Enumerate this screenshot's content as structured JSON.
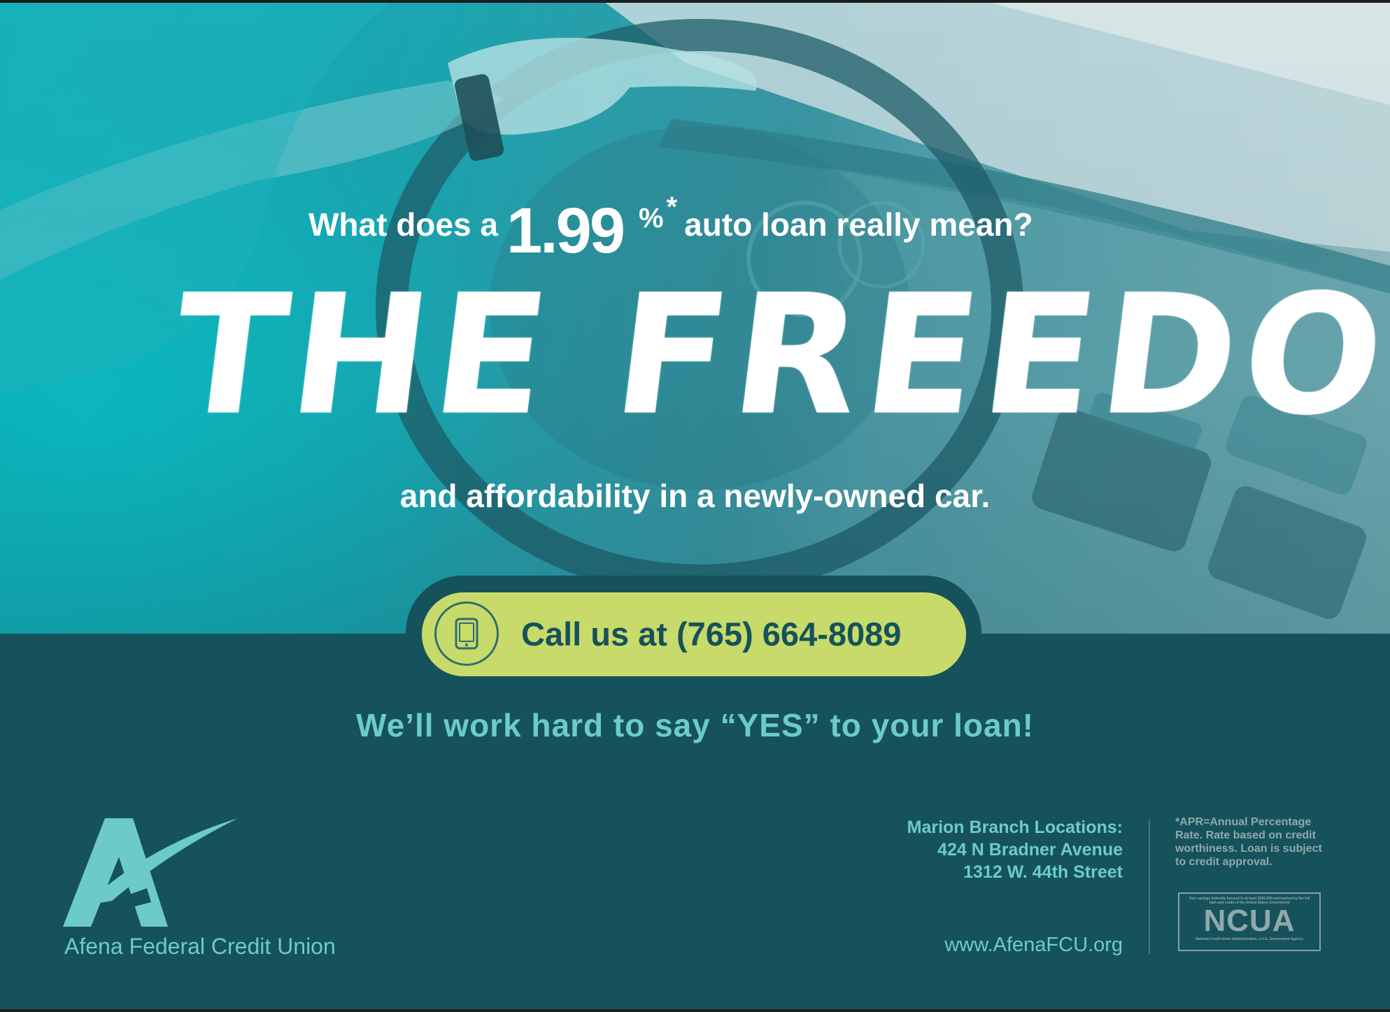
{
  "colors": {
    "teal_dark": "#16525b",
    "teal_bright": "#12aeb9",
    "accent_lime": "#c8da6a",
    "accent_aqua": "#6ccbc8",
    "white": "#ffffff"
  },
  "hero": {
    "lead_before": "What does a",
    "rate": "1.99",
    "percent": "%",
    "asterisk": "*",
    "lead_after": "auto loan really mean?",
    "headline": "THE FREEDOM",
    "subline": "and affordability in a newly-owned car."
  },
  "call": {
    "icon": "phone-icon",
    "text": "Call us at (765) 664-8089"
  },
  "tagline": "We’ll work hard to say “YES” to your loan!",
  "brand": {
    "logo_icon": "afena-logo-icon",
    "name": "Afena Federal Credit Union"
  },
  "branches": {
    "heading": "Marion Branch Locations:",
    "addresses": [
      "424 N Bradner Avenue",
      "1312 W. 44th Street"
    ]
  },
  "website": "www.AfenaFCU.org",
  "disclaimer": "*APR=Annual Percentage Rate. Rate based on credit worthiness. Loan is subject to credit approval.",
  "ncua": {
    "top_text": "Your savings federally insured to at least $250,000 and backed by the full faith and credit of the United States Government",
    "name": "NCUA",
    "bottom_text": "National Credit Union Administration, a U.S. Government Agency"
  }
}
